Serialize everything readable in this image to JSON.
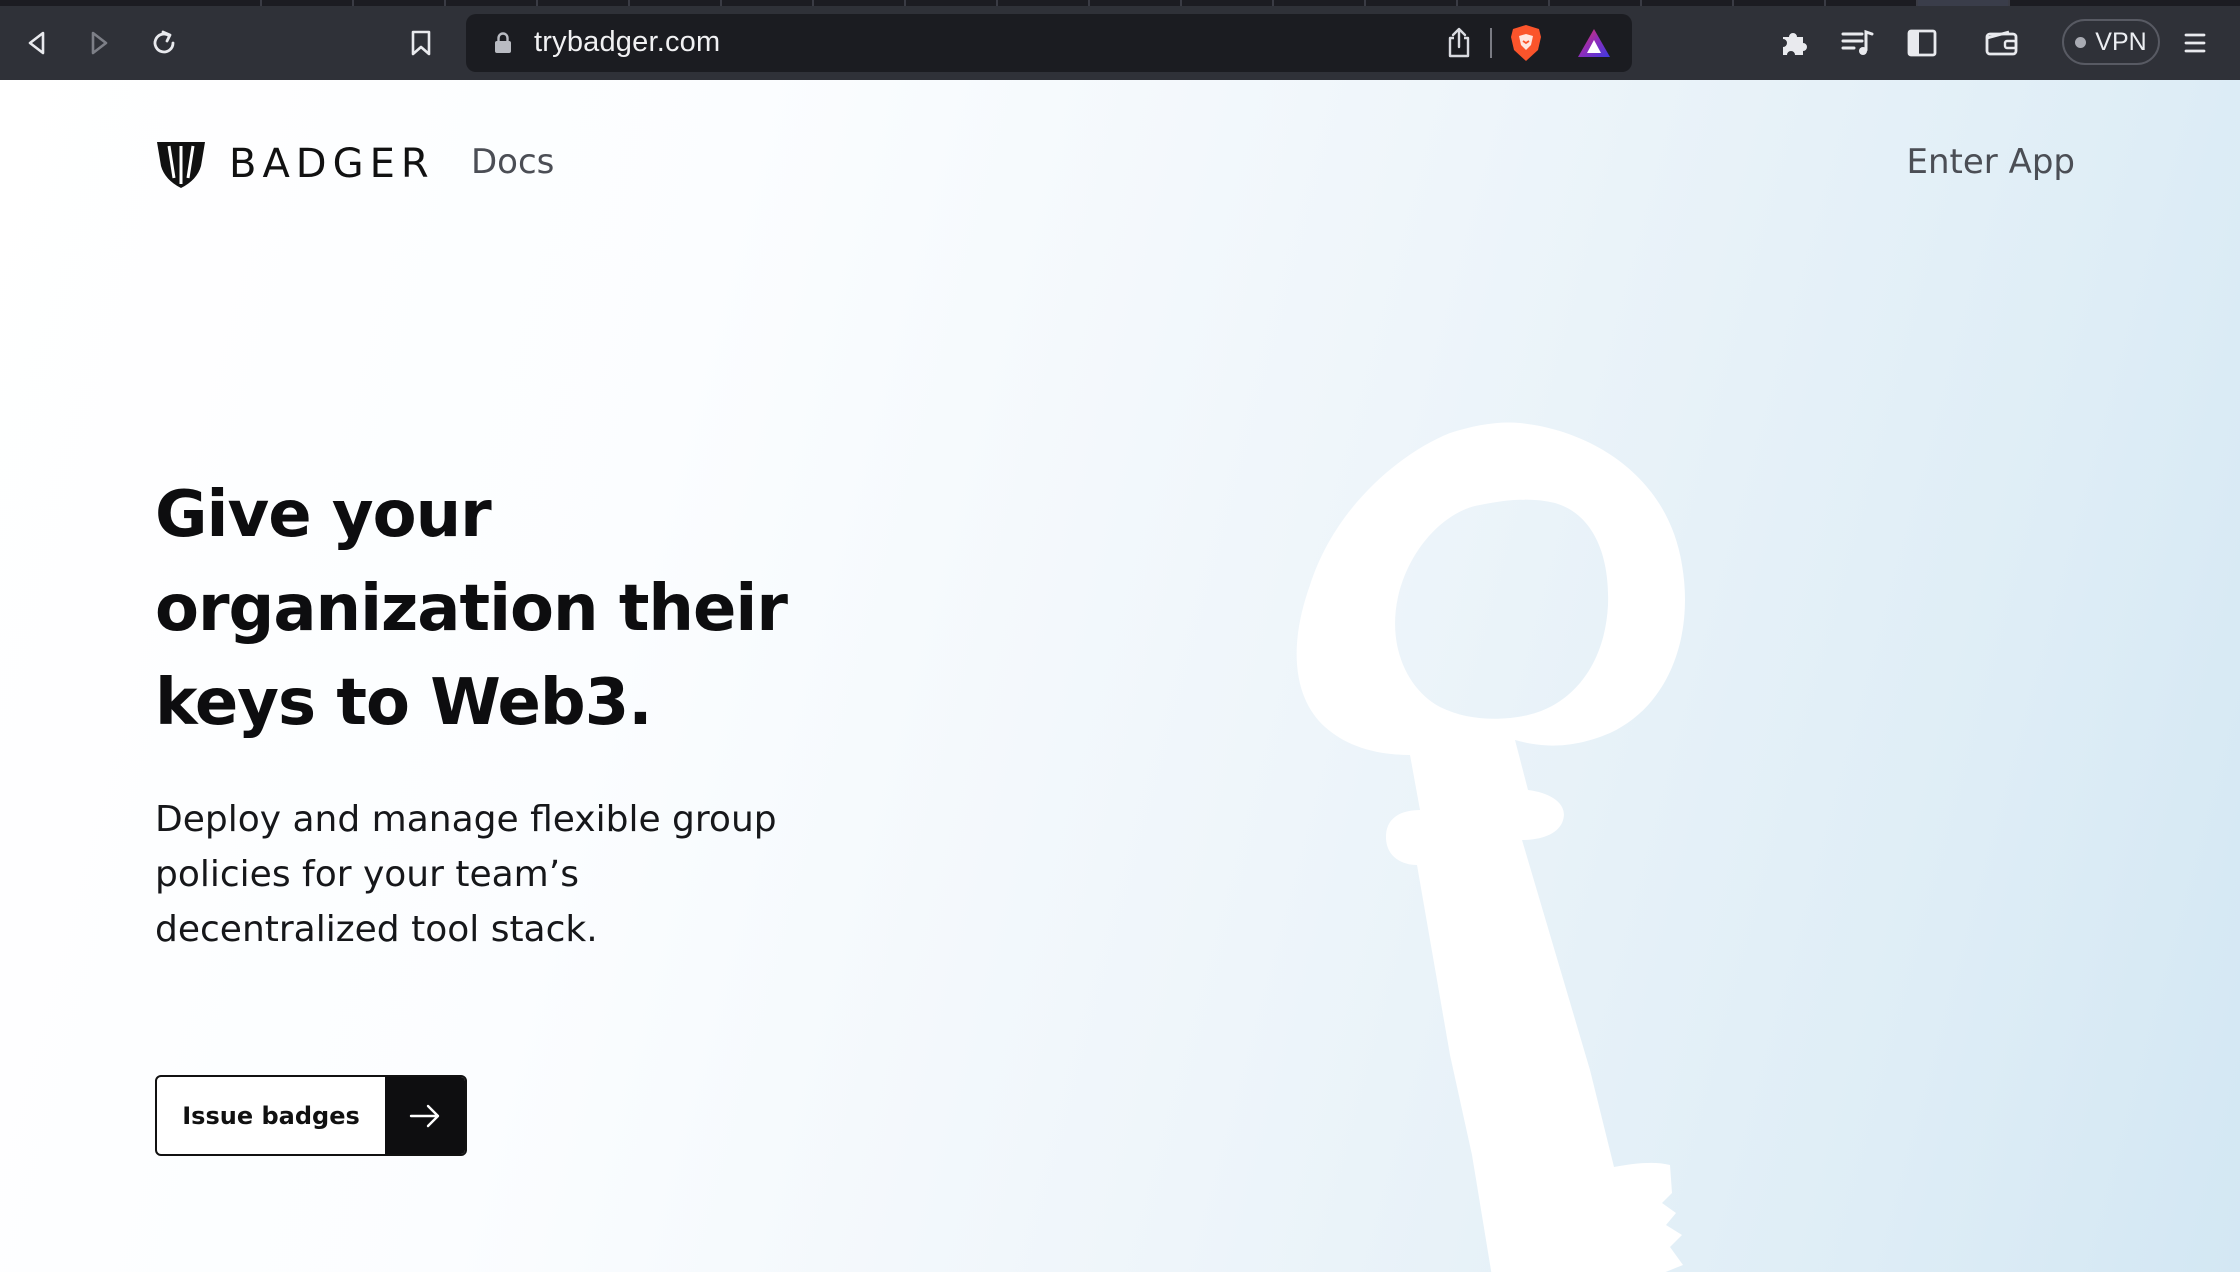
{
  "browser": {
    "url": "trybadger.com",
    "vpn_label": "VPN",
    "icons": [
      "back-icon",
      "forward-icon",
      "reload-icon",
      "bookmark-icon",
      "lock-icon",
      "share-icon",
      "brave-shields-icon",
      "brave-rewards-icon",
      "extensions-icon",
      "playlist-icon",
      "sidebar-icon",
      "wallet-icon",
      "menu-icon"
    ]
  },
  "nav": {
    "brand": "BADGER",
    "docs_link": "Docs",
    "enter_app": "Enter App"
  },
  "hero": {
    "title_line1": "Give your",
    "title_line2": "organization their",
    "title_line3": "keys to Web3.",
    "subtitle_line1": "Deploy and manage flexible group",
    "subtitle_line2": "policies for your team’s",
    "subtitle_line3": "decentralized tool stack.",
    "cta_label": "Issue badges"
  },
  "colors": {
    "chrome": "#2f3138",
    "urlbar": "#1b1c21",
    "text": "#0d0d0f",
    "muted": "#4b4e55",
    "gradient_end": "#d3e7f3",
    "brave_orange": "#fb542b"
  }
}
